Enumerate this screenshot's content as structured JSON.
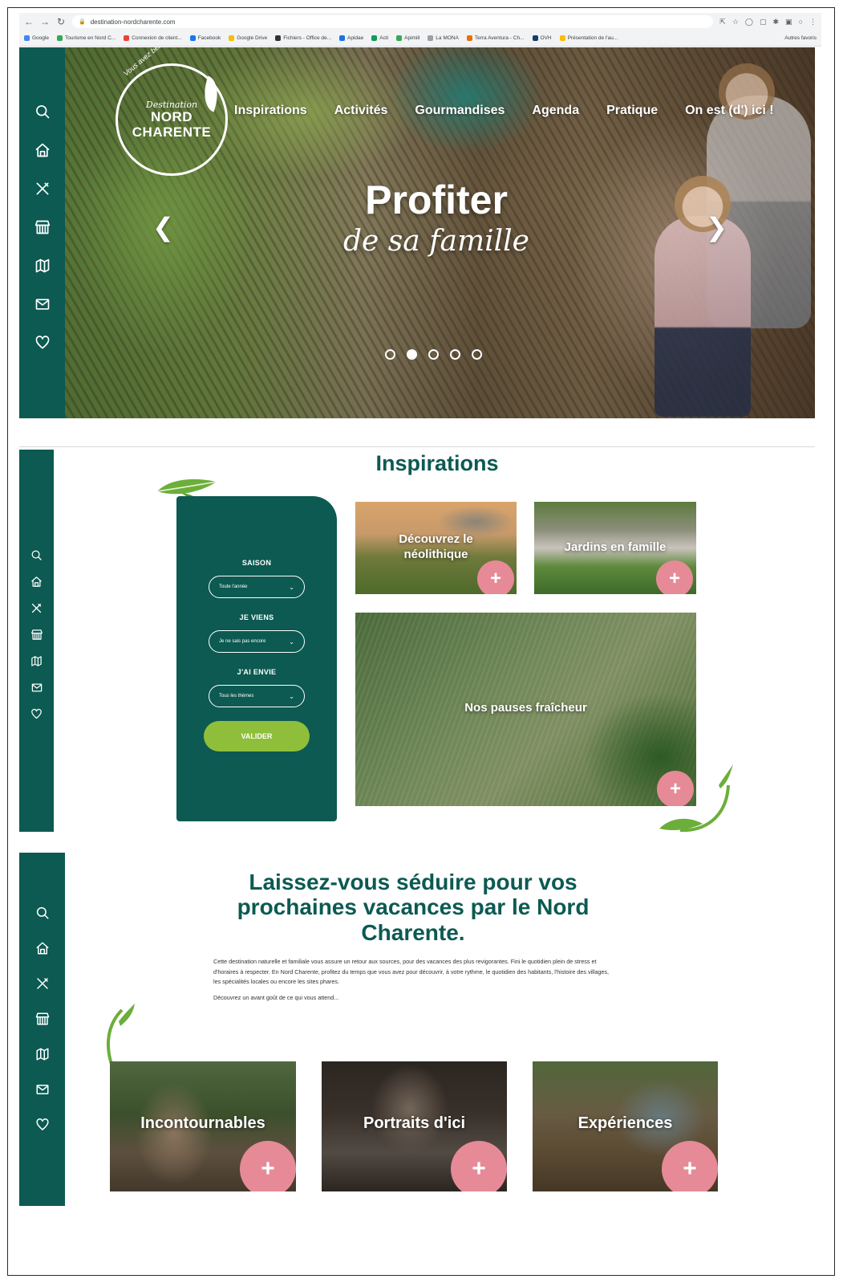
{
  "browser": {
    "url": "destination-nordcharente.com",
    "bookmarks": [
      {
        "label": "Google",
        "color": "#4285f4"
      },
      {
        "label": "Tourisme en Nord C...",
        "color": "#34a853"
      },
      {
        "label": "Connexion de client...",
        "color": "#ea4335"
      },
      {
        "label": "Facebook",
        "color": "#1877f2"
      },
      {
        "label": "Google Drive",
        "color": "#fbbc04"
      },
      {
        "label": "Fichiers - Office de...",
        "color": "#333333"
      },
      {
        "label": "Apidae",
        "color": "#1a73e8"
      },
      {
        "label": "Acti",
        "color": "#0f9d58"
      },
      {
        "label": "Apimill",
        "color": "#34a853"
      },
      {
        "label": "La MONA",
        "color": "#9aa0a6"
      },
      {
        "label": "Terra Aventura - Ch...",
        "color": "#e8710a"
      },
      {
        "label": "OVH",
        "color": "#123f6d"
      },
      {
        "label": "Présentation de l'au...",
        "color": "#fbbc04"
      }
    ],
    "other_bookmarks": "Autres favoris"
  },
  "hero": {
    "logo": {
      "arc": "Vous avez besoin d'une pause nature",
      "small": "Destination",
      "line1": "NORD",
      "line2": "CHARENTE"
    },
    "nav": [
      "Inspirations",
      "Activités",
      "Gourmandises",
      "Agenda",
      "Pratique",
      "On est (d') ici !"
    ],
    "title": "Profiter",
    "subtitle": "de sa famille",
    "slides": 5,
    "active_slide": 2
  },
  "sidebar_icons": [
    "search-icon",
    "home-icon",
    "restaurant-icon",
    "shop-icon",
    "map-icon",
    "mail-icon",
    "heart-icon"
  ],
  "inspirations": {
    "title": "Inspirations",
    "filter": {
      "saison_label": "SAISON",
      "saison_value": "Toute l'année",
      "viens_label": "JE VIENS",
      "viens_value": "Je ne sais pas encore",
      "envie_label": "J'AI ENVIE",
      "envie_value": "Tous les thèmes",
      "submit": "VALIDER"
    },
    "cards": [
      {
        "title": "Découvrez le néolithique"
      },
      {
        "title": "Jardins en famille"
      },
      {
        "title": "Nos pauses fraîcheur"
      }
    ]
  },
  "seduce": {
    "title": "Laissez-vous séduire pour vos prochaines vacances par le Nord Charente.",
    "paragraph": "Cette destination naturelle et familiale vous assure un retour aux sources, pour des vacances des plus revigorantes. Fini le quotidien plein de stress et d'horaires à respecter. En Nord Charente, profitez du temps que vous avez pour découvrir, à votre rythme, le quotidien des habitants, l'histoire des villages, les spécialités locales ou encore les sites phares.",
    "paragraph2": "Découvrez un avant goût de ce qui vous attend...",
    "cards": [
      {
        "title": "Incontournables"
      },
      {
        "title": "Portraits d'ici"
      },
      {
        "title": "Expériences"
      }
    ]
  },
  "colors": {
    "primary": "#0c5a52",
    "accent_green": "#8fbf3a",
    "pink": "#e68a97"
  }
}
